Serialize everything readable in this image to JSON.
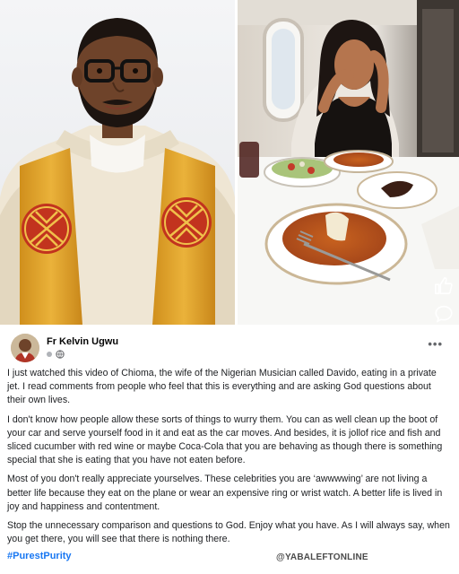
{
  "photos": {
    "left_alt": "Priest in vestment",
    "right_alt": "Woman eating jollof rice on private jet"
  },
  "reactions": {
    "like_icon": "thumbs-up-icon",
    "comment_icon": "comment-bubble-icon"
  },
  "post": {
    "author": "Fr Kelvin Ugwu",
    "audience_icon": "globe-icon",
    "more_icon_label": "•••",
    "paragraphs": [
      "I just watched this video of Chioma, the wife of the Nigerian Musician called Davido, eating in a private jet. I read comments from people who feel that this is everything and are asking God questions about their own lives.",
      "I don't know how people allow these sorts of things to wurry them. You can as well clean up the boot of your car and serve yourself food in it and eat as the car moves. And besides, it is jollof rice and fish and sliced cucumber with red wine or maybe Coca-Cola that you are behaving as though there is something special that she is eating that you have not eaten before.",
      "Most of you don't really appreciate yourselves. These celebrities you are ‘awwwwing’ are not living a better life because they eat on the plane or wear an expensive ring or wrist watch. A better life is lived in joy and happiness and contentment.",
      "Stop the unnecessary comparison and questions to God. Enjoy what you have. As I will always say, when you get there, you will see that there is nothing there."
    ],
    "hashtag": "#PurestPurity",
    "watermark": "@YABALEFTONLINE"
  },
  "colors": {
    "link_blue": "#1877f2",
    "text": "#1c1e21",
    "vestment_gold": "#e3a327",
    "vestment_cream": "#efe6d4"
  }
}
